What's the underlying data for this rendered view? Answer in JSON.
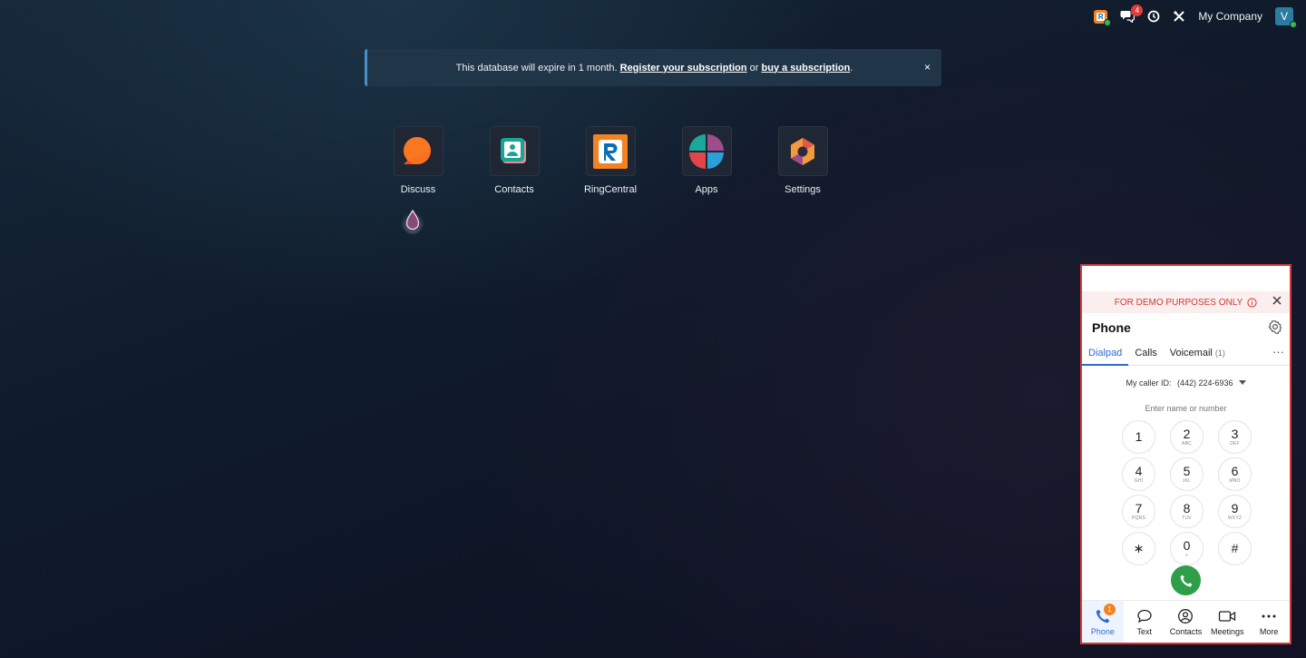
{
  "systray": {
    "messages_count": "4",
    "company": "My Company",
    "user_initial": "V"
  },
  "alert": {
    "text_before": "This database will expire in 1 month.",
    "link_register": "Register your subscription",
    "text_or": "or",
    "link_buy": "buy a subscription",
    "text_after": ".",
    "close_symbol": "×"
  },
  "apps": [
    {
      "label": "Discuss",
      "icon": "discuss-icon"
    },
    {
      "label": "Contacts",
      "icon": "contacts-icon"
    },
    {
      "label": "RingCentral",
      "icon": "ringcentral-icon"
    },
    {
      "label": "Apps",
      "icon": "apps-icon"
    },
    {
      "label": "Settings",
      "icon": "settings-icon"
    }
  ],
  "phone": {
    "demo_banner": "FOR DEMO PURPOSES ONLY",
    "title": "Phone",
    "tabs": [
      {
        "label": "Dialpad"
      },
      {
        "label": "Calls"
      },
      {
        "label": "Voicemail",
        "count": "(1)"
      }
    ],
    "tabs_more": "···",
    "caller_id_label": "My caller ID:",
    "caller_id_number": "(442) 224-6936",
    "input_placeholder": "Enter name or number",
    "keys": [
      {
        "digit": "1",
        "letters": ""
      },
      {
        "digit": "2",
        "letters": "ABC"
      },
      {
        "digit": "3",
        "letters": "DEF"
      },
      {
        "digit": "4",
        "letters": "GHI"
      },
      {
        "digit": "5",
        "letters": "JKL"
      },
      {
        "digit": "6",
        "letters": "MNO"
      },
      {
        "digit": "7",
        "letters": "PQRS"
      },
      {
        "digit": "8",
        "letters": "TUV"
      },
      {
        "digit": "9",
        "letters": "WXYZ"
      },
      {
        "digit": "∗",
        "letters": ""
      },
      {
        "digit": "0",
        "letters": "+"
      },
      {
        "digit": "#",
        "letters": ""
      }
    ],
    "nav": [
      {
        "label": "Phone",
        "badge": "1"
      },
      {
        "label": "Text"
      },
      {
        "label": "Contacts"
      },
      {
        "label": "Meetings"
      },
      {
        "label": "More"
      }
    ]
  },
  "colors": {
    "accent_blue": "#2e6bd3",
    "call_green": "#2f9e49",
    "demo_red": "#d0392f",
    "ringcentral_orange": "#f58220"
  }
}
